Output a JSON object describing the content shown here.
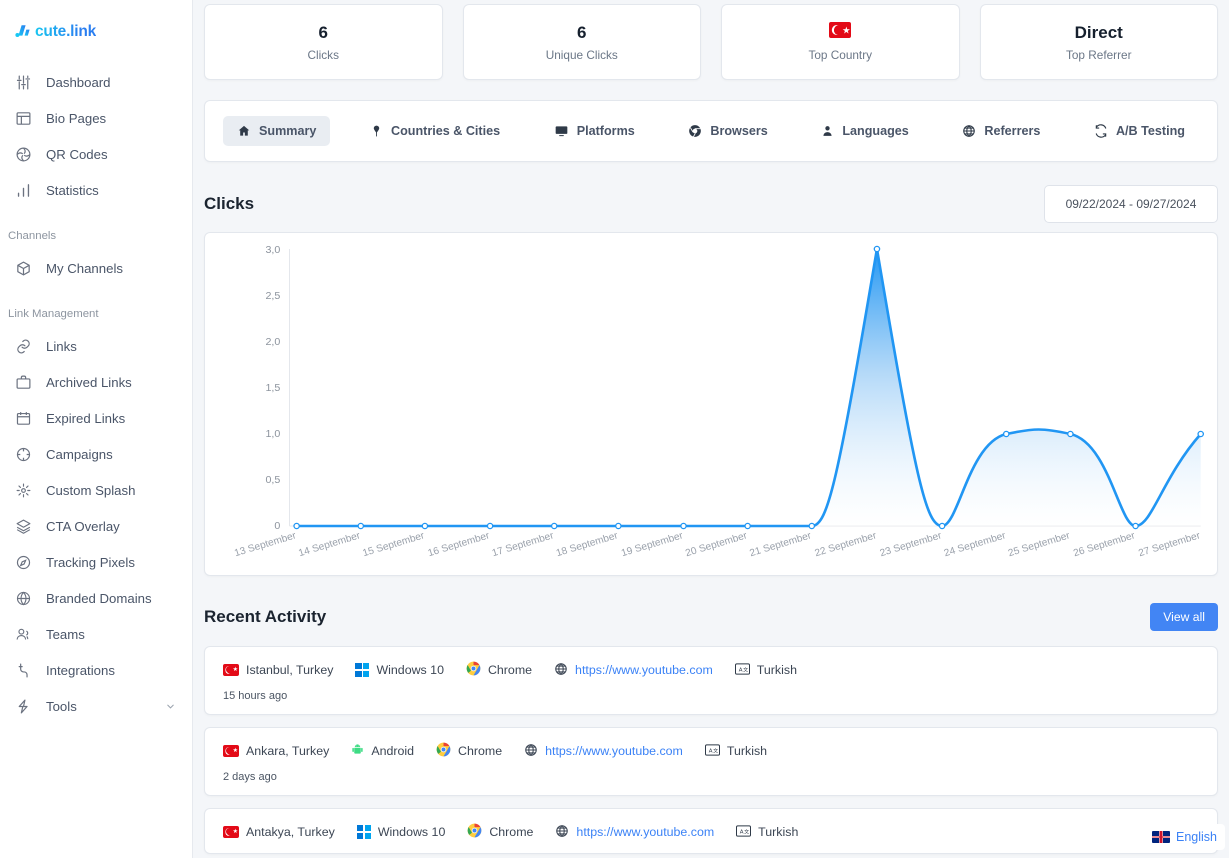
{
  "brand": {
    "logo_text": "cute.link",
    "logo_icon": "cutelink-logo-icon"
  },
  "sidebar": {
    "groups": [
      {
        "section": null,
        "items": [
          {
            "label": "Dashboard",
            "icon": "sliders-icon"
          },
          {
            "label": "Bio Pages",
            "icon": "layout-icon"
          },
          {
            "label": "QR Codes",
            "icon": "qrcode-aperture-icon"
          },
          {
            "label": "Statistics",
            "icon": "bar-chart-icon"
          }
        ]
      },
      {
        "section": "Channels",
        "items": [
          {
            "label": "My Channels",
            "icon": "box-icon"
          }
        ]
      },
      {
        "section": "Link Management",
        "items": [
          {
            "label": "Links",
            "icon": "link-icon"
          },
          {
            "label": "Archived Links",
            "icon": "briefcase-icon"
          },
          {
            "label": "Expired Links",
            "icon": "calendar-icon"
          },
          {
            "label": "Campaigns",
            "icon": "target-icon"
          },
          {
            "label": "Custom Splash",
            "icon": "sparkle-icon"
          },
          {
            "label": "CTA Overlay",
            "icon": "layers-icon"
          },
          {
            "label": "Tracking Pixels",
            "icon": "compass-icon"
          },
          {
            "label": "Branded Domains",
            "icon": "globe-icon"
          },
          {
            "label": "Teams",
            "icon": "users-icon"
          },
          {
            "label": "Integrations",
            "icon": "plug-icon"
          },
          {
            "label": "Tools",
            "icon": "bolt-icon",
            "chevron": "chevron-down-icon"
          }
        ]
      }
    ]
  },
  "stats": [
    {
      "value": "6",
      "label": "Clicks",
      "type": "text"
    },
    {
      "value": "6",
      "label": "Unique Clicks",
      "type": "text"
    },
    {
      "value": "",
      "label": "Top Country",
      "type": "flag",
      "flag": "turkey-flag-icon"
    },
    {
      "value": "Direct",
      "label": "Top Referrer",
      "type": "text"
    }
  ],
  "tabs": [
    {
      "label": "Summary",
      "icon": "home-icon",
      "active": true
    },
    {
      "label": "Countries & Cities",
      "icon": "pin-icon",
      "active": false
    },
    {
      "label": "Platforms",
      "icon": "monitor-icon",
      "active": false
    },
    {
      "label": "Browsers",
      "icon": "chrome-icon",
      "active": false
    },
    {
      "label": "Languages",
      "icon": "person-icon",
      "active": false
    },
    {
      "label": "Referrers",
      "icon": "globe-icon",
      "active": false
    },
    {
      "label": "A/B Testing",
      "icon": "refresh-icon",
      "active": false
    }
  ],
  "clicks_section": {
    "title": "Clicks",
    "date_range": "09/22/2024 - 09/27/2024"
  },
  "chart_data": {
    "type": "line",
    "title": "Clicks",
    "xlabel": "",
    "ylabel": "",
    "categories": [
      "13 September",
      "14 September",
      "15 September",
      "16 September",
      "17 September",
      "18 September",
      "19 September",
      "20 September",
      "21 September",
      "22 September",
      "23 September",
      "24 September",
      "25 September",
      "26 September",
      "27 September"
    ],
    "values": [
      0,
      0,
      0,
      0,
      0,
      0,
      0,
      0,
      0,
      3,
      0,
      1,
      1,
      0,
      1
    ],
    "ylim": [
      0,
      3
    ],
    "ytick_labels": [
      "0",
      "0,5",
      "1,0",
      "1,5",
      "2,0",
      "2,5",
      "3,0"
    ],
    "ytick_values": [
      0,
      0.5,
      1.0,
      1.5,
      2.0,
      2.5,
      3.0
    ],
    "grid": false,
    "legend": false,
    "line_color": "#2196f3",
    "fill_gradient_from": "#2196f3",
    "fill_gradient_to": "#ffffff",
    "curve": "smooth",
    "markers": true
  },
  "recent_activity": {
    "title": "Recent Activity",
    "view_all_label": "View all",
    "entries": [
      {
        "location": "Istanbul, Turkey",
        "location_icon": "turkey-flag-icon",
        "platform": "Windows 10",
        "platform_icon": "windows-icon",
        "browser": "Chrome",
        "browser_icon": "chrome-icon",
        "referrer": "https://www.youtube.com",
        "referrer_icon": "globe-icon",
        "language": "Turkish",
        "language_icon": "translate-icon",
        "time": "15 hours ago"
      },
      {
        "location": "Ankara, Turkey",
        "location_icon": "turkey-flag-icon",
        "platform": "Android",
        "platform_icon": "android-icon",
        "browser": "Chrome",
        "browser_icon": "chrome-icon",
        "referrer": "https://www.youtube.com",
        "referrer_icon": "globe-icon",
        "language": "Turkish",
        "language_icon": "translate-icon",
        "time": "2 days ago"
      },
      {
        "location": "Antakya, Turkey",
        "location_icon": "turkey-flag-icon",
        "platform": "Windows 10",
        "platform_icon": "windows-icon",
        "browser": "Chrome",
        "browser_icon": "chrome-icon",
        "referrer": "https://www.youtube.com",
        "referrer_icon": "globe-icon",
        "language": "Turkish",
        "language_icon": "translate-icon",
        "time": ""
      }
    ]
  },
  "language_widget": {
    "label": "English",
    "icon": "uk-flag-icon"
  },
  "colors": {
    "accent_blue": "#4285f4",
    "chart_blue": "#2196f3",
    "link_blue": "#3b82f6",
    "page_bg": "#f4f6f9",
    "card_bg": "#ffffff",
    "flag_red": "#e30a17"
  }
}
